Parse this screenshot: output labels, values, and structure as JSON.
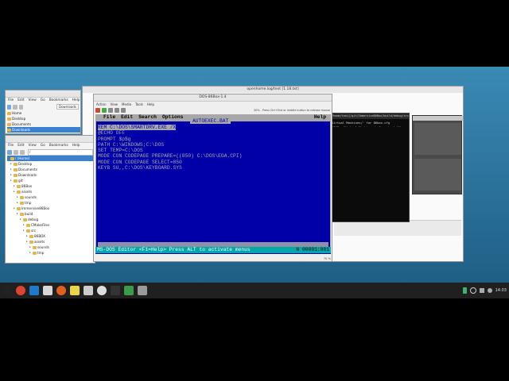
{
  "desktop": {
    "bg_top": "#3a8ab5",
    "bg_bottom": "#1f5f86"
  },
  "back_window": {
    "title": "openhome.log/text [1.18.txt]",
    "panel_rows": [
      "",
      ""
    ]
  },
  "fm1": {
    "title": "",
    "menu": [
      "File",
      "Edit",
      "View",
      "Go",
      "Bookmarks",
      "Help"
    ],
    "toolbar_label": "Downloads",
    "items": [
      {
        "label": "Home",
        "selected": false
      },
      {
        "label": "Desktop",
        "selected": false
      },
      {
        "label": "Documents",
        "selected": false
      },
      {
        "label": "Downloads",
        "selected": true
      }
    ]
  },
  "fm2": {
    "title": "",
    "menu": [
      "File",
      "Edit",
      "View",
      "Go",
      "Bookmarks",
      "Help"
    ],
    "address": "/",
    "items": [
      {
        "label": "/ (Home)",
        "indent": 0,
        "selected": true
      },
      {
        "label": "Desktop",
        "indent": 1
      },
      {
        "label": "Documents",
        "indent": 1
      },
      {
        "label": "Downloads",
        "indent": 1
      },
      {
        "label": "git",
        "indent": 1
      },
      {
        "label": "86Box",
        "indent": 2
      },
      {
        "label": "assets",
        "indent": 2
      },
      {
        "label": "sounds",
        "indent": 3
      },
      {
        "label": "tmp",
        "indent": 3
      },
      {
        "label": "Immersive86Box",
        "indent": 2
      },
      {
        "label": "build",
        "indent": 3
      },
      {
        "label": "debug",
        "indent": 4
      },
      {
        "label": "CMakeFiles",
        "indent": 5
      },
      {
        "label": "src",
        "indent": 5
      },
      {
        "label": "86BOX",
        "indent": 6
      },
      {
        "label": "assets",
        "indent": 6
      },
      {
        "label": "sounds",
        "indent": 7
      },
      {
        "label": "tmp",
        "indent": 7
      }
    ]
  },
  "terminal": {
    "title": "/home/tonij/git/Immersive86Box/build/debug/src",
    "lines": [
      "Virtual Machines/' for 86box.cfg",
      "/86Box/Virtual Machines/. Scan took 16",
      "",
      "es / load",
      "",
      "all Command: '/home/tonij/git/Immersive",
      "' /home/tonij/.local/share/86Box/Virtua",
      "ttings'",
      "",
      "Respond to data received events here.",
      "",
      "",
      "all Command: '/home/tonij/git/Immersive",
      "' /home/tonij/.local/share/86Box/Virtua",
      "",
      "",
      "Respond to data received events here.",
      "",
      "Respond to data received events here."
    ]
  },
  "dos_window": {
    "title": "DOS-86Box-1.4",
    "menu": [
      "Action",
      "View",
      "Media",
      "Tools",
      "Help"
    ],
    "status_hint": "30% - Press Ctrl+End or middle button to release mouse",
    "statusbar_left": "",
    "statusbar_right": "70 %"
  },
  "dos_editor": {
    "menu": [
      "File",
      "Edit",
      "Search",
      "Options"
    ],
    "help": "Help",
    "filename": "AUTOEXEC.BAT",
    "lines": [
      "REM C:\\DOS\\SMARTDRV.EXE /X",
      "@ECHO OFF",
      "PROMPT $p$g",
      "PATH C:\\WINDOWS;C:\\DOS",
      "SET TEMP=C:\\DOS",
      "MODE CON CODEPAGE PREPARE=((850) C:\\DOS\\EGA.CPI)",
      "MODE CON CODEPAGE SELECT=850",
      "KEYB SU,,C:\\DOS\\KEYBOARD.SYS"
    ],
    "status_left": "MS-DOS Editor  <F1=Help> Press ALT to activate menus",
    "status_right": "N 00001:001"
  },
  "taskbar": {
    "clock": "14:03",
    "icons": [
      {
        "name": "system-icon",
        "color": "#222"
      },
      {
        "name": "chrome-icon",
        "color": "#dd4433"
      },
      {
        "name": "vscode-icon",
        "color": "#1f7acc"
      },
      {
        "name": "files-icon",
        "color": "#d8d8d8"
      },
      {
        "name": "firefox-icon",
        "color": "#e06020"
      },
      {
        "name": "text-editor-icon",
        "color": "#e8d44d"
      },
      {
        "name": "editor-icon",
        "color": "#cccccc"
      },
      {
        "name": "clock-icon",
        "color": "#dddddd"
      },
      {
        "name": "terminal-icon",
        "color": "#333333"
      },
      {
        "name": "media-icon",
        "color": "#3a9c4a"
      },
      {
        "name": "gears-icon",
        "color": "#9a9a9a"
      }
    ]
  }
}
